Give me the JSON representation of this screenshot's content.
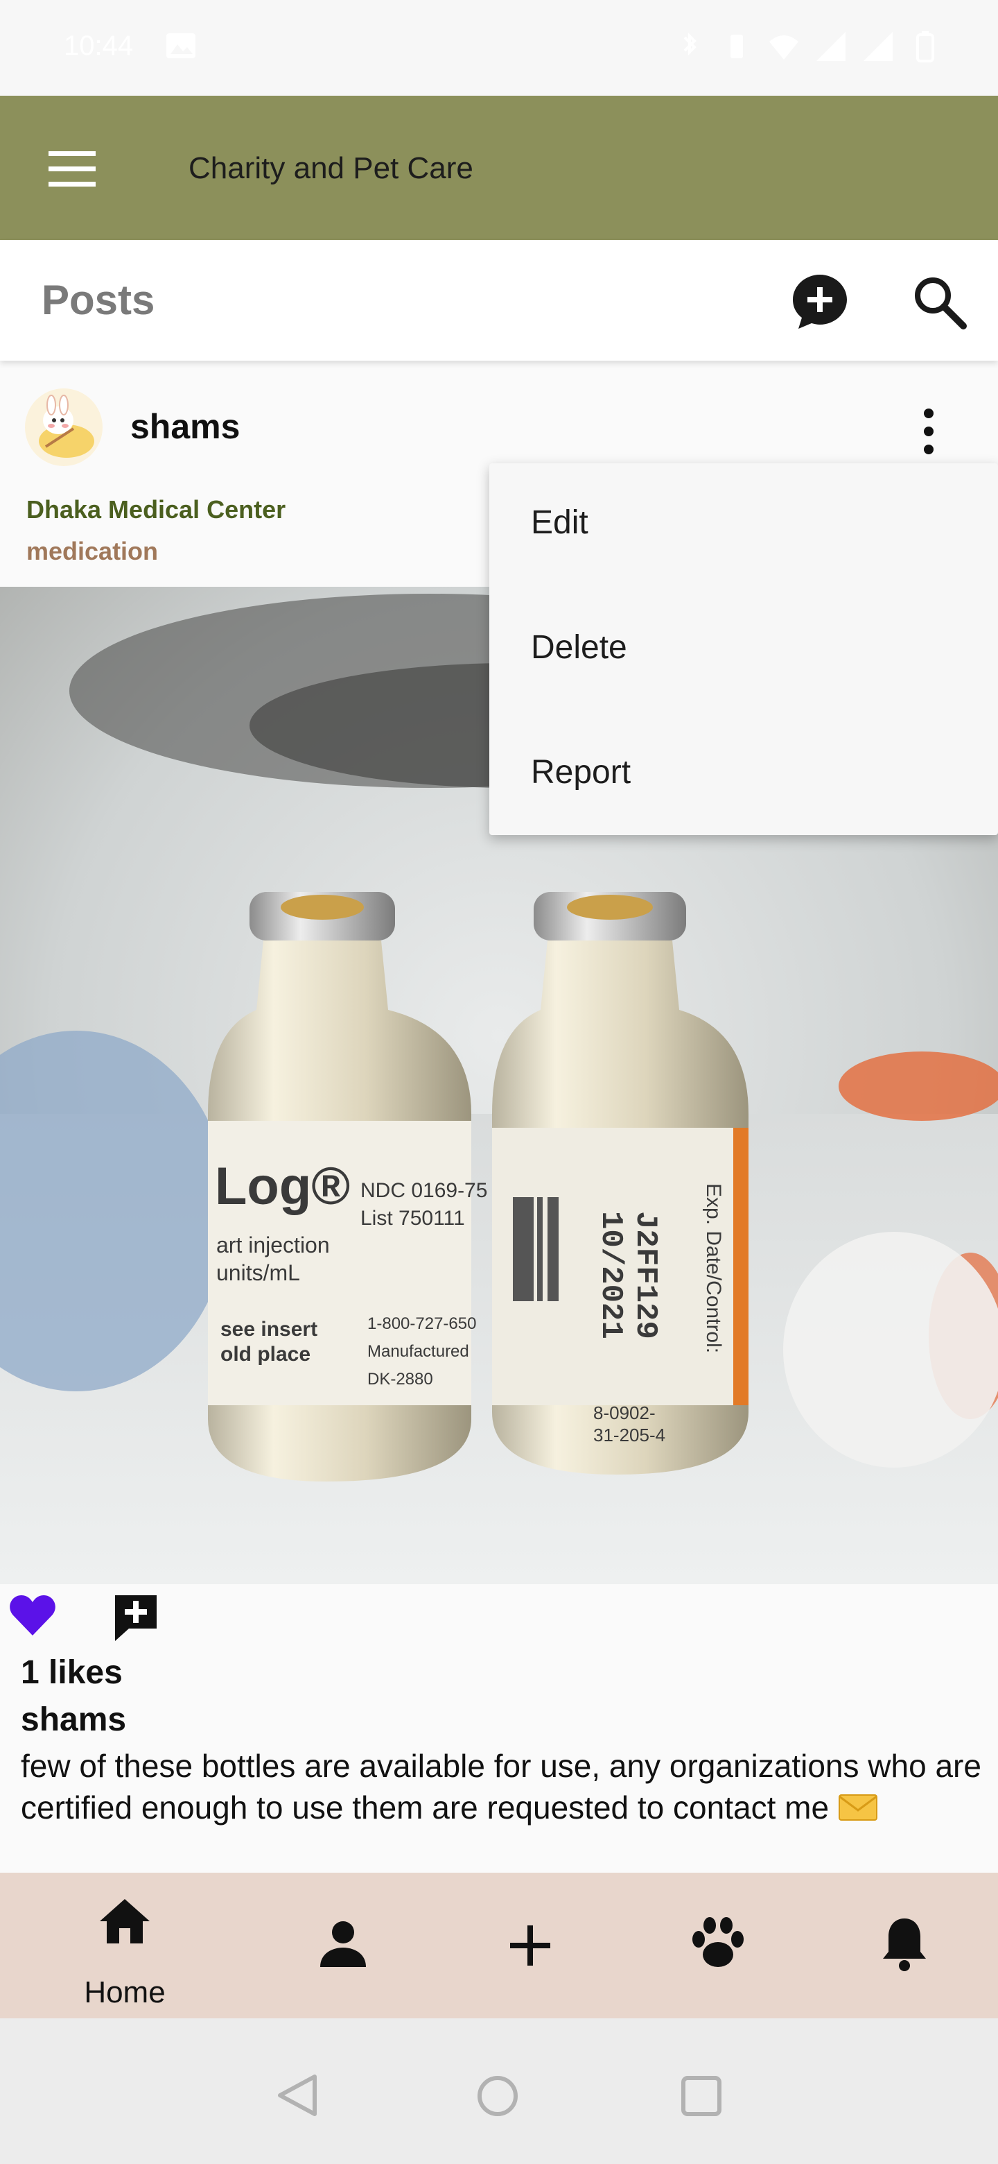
{
  "status_bar": {
    "time": "10:44"
  },
  "app_bar": {
    "title": "Charity and Pet Care"
  },
  "posts_header": {
    "label": "Posts"
  },
  "post": {
    "username": "shams",
    "location": "Dhaka Medical Center",
    "category": "medication",
    "likes_text": "1 likes",
    "caption_username": "shams",
    "caption": "few of these bottles are available for use, any organizations who are certified enough to use them are requested to contact me",
    "liked": true
  },
  "photo": {
    "vial_left": {
      "brand": "Log®",
      "lines": [
        "NDC 0169-75",
        "List 750111",
        "art injection",
        "units/mL",
        "see insert",
        "old place",
        "1-800-727-650",
        "Manufactured",
        "DK-2880"
      ]
    },
    "vial_right": {
      "date": "10/2021",
      "lot": "J2FF129",
      "code1": "8-0902-",
      "code2": "31-205-4",
      "side": "Exp. Date/Control:"
    }
  },
  "dropdown": {
    "items": [
      {
        "label": "Edit"
      },
      {
        "label": "Delete"
      },
      {
        "label": "Report"
      }
    ]
  },
  "bottom_nav": {
    "items": [
      {
        "icon": "home-icon",
        "label": "Home",
        "active": true
      },
      {
        "icon": "person-icon"
      },
      {
        "icon": "plus-icon"
      },
      {
        "icon": "paw-icon"
      },
      {
        "icon": "bell-icon"
      }
    ]
  },
  "colors": {
    "app_bar": "#8c905b",
    "location": "#4b5f1f",
    "category": "#a0785a",
    "heart": "#5b12e8",
    "bottom_nav": "#e8d6cc"
  }
}
